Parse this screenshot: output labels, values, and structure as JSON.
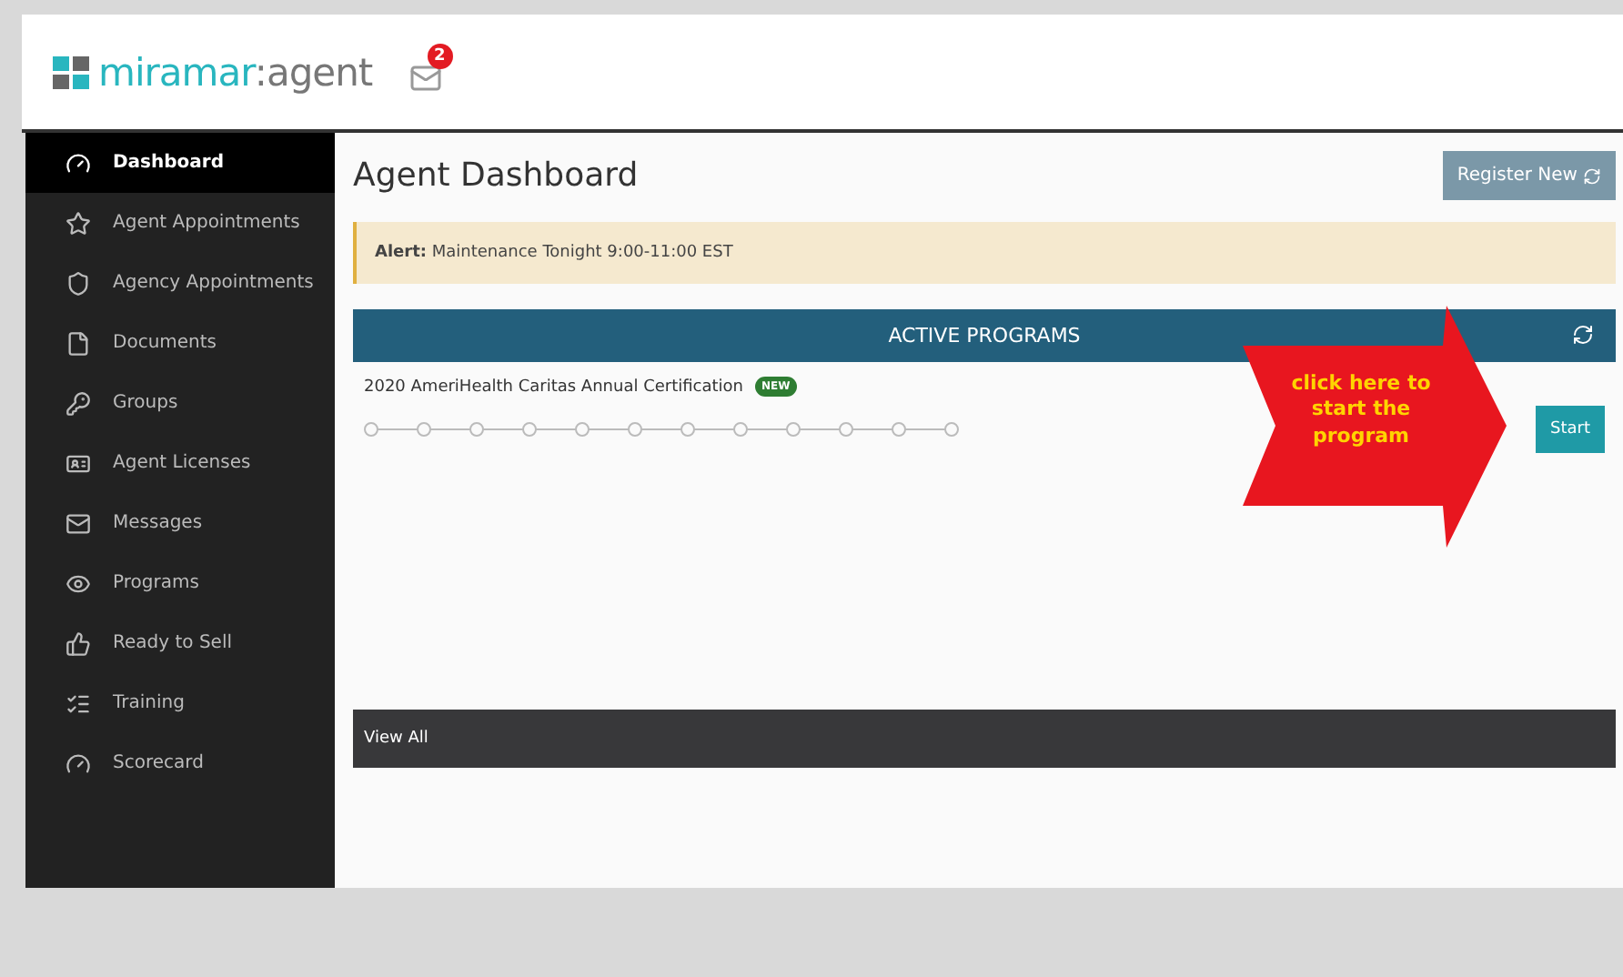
{
  "header": {
    "logo_brand": "miramar",
    "logo_sep": ":",
    "logo_suffix": "agent",
    "mail_count": "2"
  },
  "sidebar": {
    "items": [
      {
        "label": "Dashboard",
        "selected": true
      },
      {
        "label": "Agent Appointments",
        "selected": false
      },
      {
        "label": "Agency Appointments",
        "selected": false
      },
      {
        "label": "Documents",
        "selected": false
      },
      {
        "label": "Groups",
        "selected": false
      },
      {
        "label": "Agent Licenses",
        "selected": false
      },
      {
        "label": "Messages",
        "selected": false
      },
      {
        "label": "Programs",
        "selected": false
      },
      {
        "label": "Ready to Sell",
        "selected": false
      },
      {
        "label": "Training",
        "selected": false
      },
      {
        "label": "Scorecard",
        "selected": false
      }
    ]
  },
  "page": {
    "title": "Agent Dashboard",
    "register_button": "Register New"
  },
  "alert": {
    "label": "Alert:",
    "text": "Maintenance Tonight 9:00-11:00 EST"
  },
  "programs": {
    "title": "ACTIVE PROGRAMS",
    "rows": [
      {
        "name": "2020 AmeriHealth Caritas Annual Certification",
        "badge": "NEW",
        "button": "Start",
        "steps": [
          {
            "done": false
          },
          {
            "done": false
          },
          {
            "done": false
          },
          {
            "done": false
          },
          {
            "done": false
          },
          {
            "done": false
          },
          {
            "done": false
          },
          {
            "done": false
          },
          {
            "done": false
          },
          {
            "done": false
          },
          {
            "done": false
          },
          {
            "done": false
          }
        ]
      }
    ],
    "footer": "View All"
  },
  "callout": {
    "text": "click here to start the program"
  }
}
